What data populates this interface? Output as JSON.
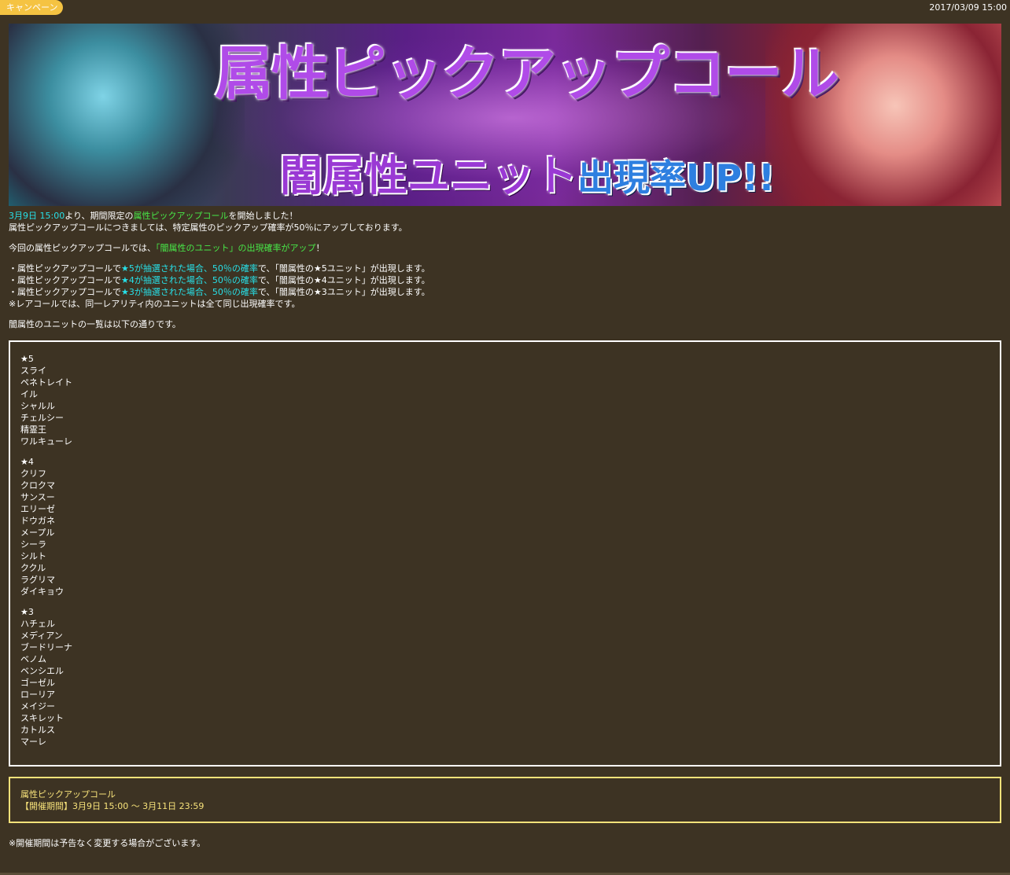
{
  "header": {
    "tag_label": "キャンペーン",
    "date": "2017/03/09 15:00"
  },
  "banner": {
    "title_main": "属性ピックアップコール",
    "title_sub": "闇属性ユニット",
    "title_sub_up": "出現率UP!!"
  },
  "intro": {
    "start_time": "3月9日 15:00",
    "line1_mid": "より、期間限定の",
    "line1_highlight": "属性ピックアップコール",
    "line1_end": "を開始しました！",
    "line2": "属性ピックアップコールにつきましては、特定属性のピックアップ確率が50％にアップしております。",
    "line3_start": "今回の属性ピックアップコールでは、",
    "line3_highlight": "「闇属性のユニット」の出現確率がアップ",
    "line3_end": "！"
  },
  "rates": [
    {
      "prefix": "・属性ピックアップコールで",
      "highlight": "★5が抽選された場合、50％の確率",
      "suffix": "で、「闇属性の★5ユニット」が出現します。"
    },
    {
      "prefix": "・属性ピックアップコールで",
      "highlight": "★4が抽選された場合、50％の確率",
      "suffix": "で、「闇属性の★4ユニット」が出現します。"
    },
    {
      "prefix": "・属性ピックアップコールで",
      "highlight": "★3が抽選された場合、50％の確率",
      "suffix": "で、「闇属性の★3ユニット」が出現します。"
    }
  ],
  "rare_note": "※レアコールでは、同一レアリティ内のユニットは全て同じ出現確率です。",
  "list_intro": "闇属性のユニットの一覧は以下の通りです。",
  "unit_groups": [
    {
      "rarity": "★5",
      "units": [
        "スライ",
        "ペネトレイト",
        "イル",
        "シャルル",
        "チェルシー",
        "精霊王",
        "ワルキューレ"
      ]
    },
    {
      "rarity": "★4",
      "units": [
        "クリフ",
        "クロクマ",
        "サンスー",
        "エリーゼ",
        "ドウガネ",
        "メープル",
        "シーラ",
        "シルト",
        "ククル",
        "ラグリマ",
        "ダイキョウ"
      ]
    },
    {
      "rarity": "★3",
      "units": [
        "ハチェル",
        "メディアン",
        "ブードリーナ",
        "ベノム",
        "ベンシエル",
        "ゴーゼル",
        "ローリア",
        "メイジー",
        "スキレット",
        "カトルス",
        "マーレ"
      ]
    }
  ],
  "period": {
    "title": "属性ピックアップコール",
    "range": "【開催期間】3月9日 15:00 ～ 3月11日 23:59"
  },
  "footnote": "※開催期間は予告なく変更する場合がございます。",
  "colors": {
    "background": "#3d3323",
    "tag": "#f5c342",
    "highlight_cyan": "#27e0e8",
    "highlight_green": "#48e848",
    "period_border": "#f7e27a"
  }
}
